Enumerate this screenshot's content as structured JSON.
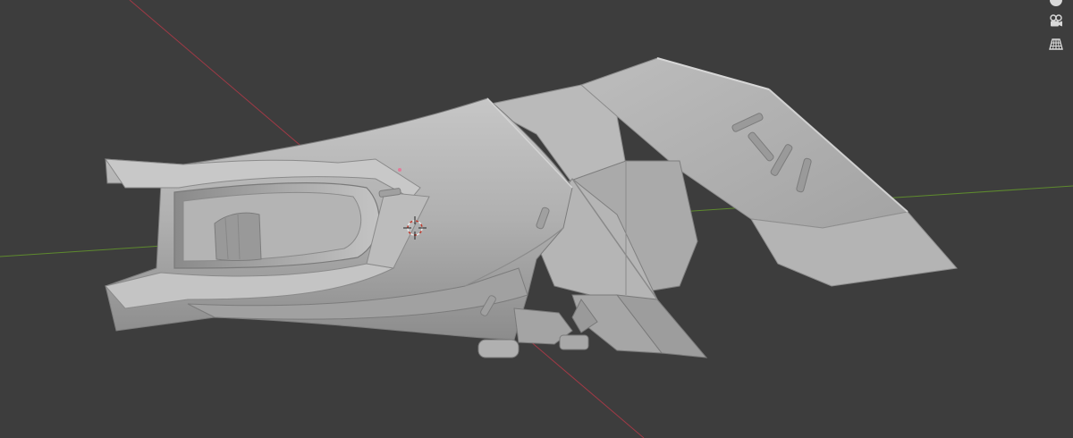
{
  "viewport": {
    "background": "#3d3d3d",
    "grid_color": "#444444",
    "x_axis_color": "#a03a46",
    "y_axis_color": "#5e8a2e",
    "object": {
      "type": "sculpted-mesh",
      "base_color": "#a9a9a9",
      "highlight_color": "#c9c9c9",
      "shadow_color": "#6e6e6e"
    },
    "cursor_color": "#e2e2e2"
  },
  "gizmo": {
    "items": [
      {
        "name": "navigate-gizmo-top",
        "icon": "sphere-icon"
      },
      {
        "name": "camera-view-button",
        "icon": "camera-icon"
      },
      {
        "name": "perspective-toggle-button",
        "icon": "grid-icon"
      }
    ]
  }
}
